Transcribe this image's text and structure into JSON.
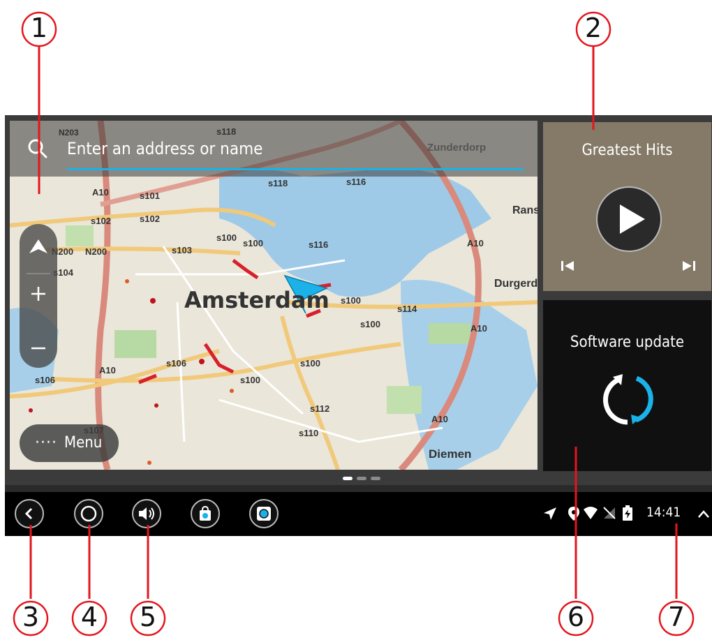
{
  "search": {
    "placeholder": "Enter an address or name"
  },
  "map": {
    "city": "Amsterdam",
    "place_labels": [
      "Zunderdorp",
      "Rans",
      "Durgerd",
      "Diemen"
    ],
    "road_labels": [
      "N203",
      "A10",
      "s118",
      "s101",
      "s102",
      "s102",
      "s118",
      "s116",
      "N200",
      "N200",
      "s103",
      "s100",
      "s100",
      "s116",
      "s104",
      "A10",
      "s100",
      "s114",
      "s100",
      "A10",
      "s106",
      "s100",
      "s100",
      "s106",
      "A10",
      "s112",
      "s110",
      "A10",
      "s107"
    ],
    "menu_dots": "····",
    "menu_label": "Menu"
  },
  "music_panel": {
    "title": "Greatest Hits"
  },
  "update_panel": {
    "title": "Software update"
  },
  "status_bar": {
    "time": "14:41"
  },
  "callouts": [
    "1",
    "2",
    "3",
    "4",
    "5",
    "6",
    "7"
  ],
  "colors": {
    "accent": "#1ab2e8",
    "callout_line": "#e3161d",
    "route_red": "#d8202a",
    "water": "#9ecae8"
  }
}
